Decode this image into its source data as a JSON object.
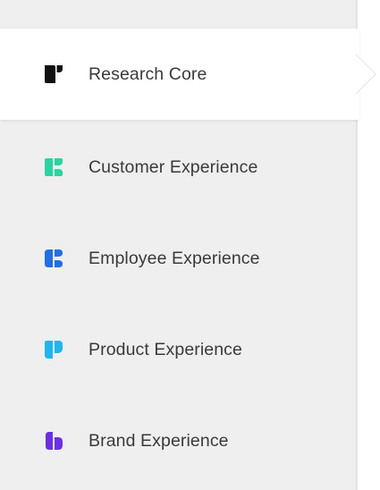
{
  "nav": {
    "items": [
      {
        "label": "Research Core",
        "icon": "research-core-logo-icon",
        "color": "#111111",
        "active": true
      },
      {
        "label": "Customer Experience",
        "icon": "customer-experience-logo-icon",
        "color": "#27d6a0",
        "active": false
      },
      {
        "label": "Employee Experience",
        "icon": "employee-experience-logo-icon",
        "color": "#1f6fe6",
        "active": false
      },
      {
        "label": "Product Experience",
        "icon": "product-experience-logo-icon",
        "color": "#1bb7f0",
        "active": false
      },
      {
        "label": "Brand Experience",
        "icon": "brand-experience-logo-icon",
        "color": "#6a2ee8",
        "active": false
      }
    ]
  },
  "colors": {
    "panel_background": "#efefef",
    "active_background": "#ffffff",
    "label_text": "#3a3a3a"
  }
}
